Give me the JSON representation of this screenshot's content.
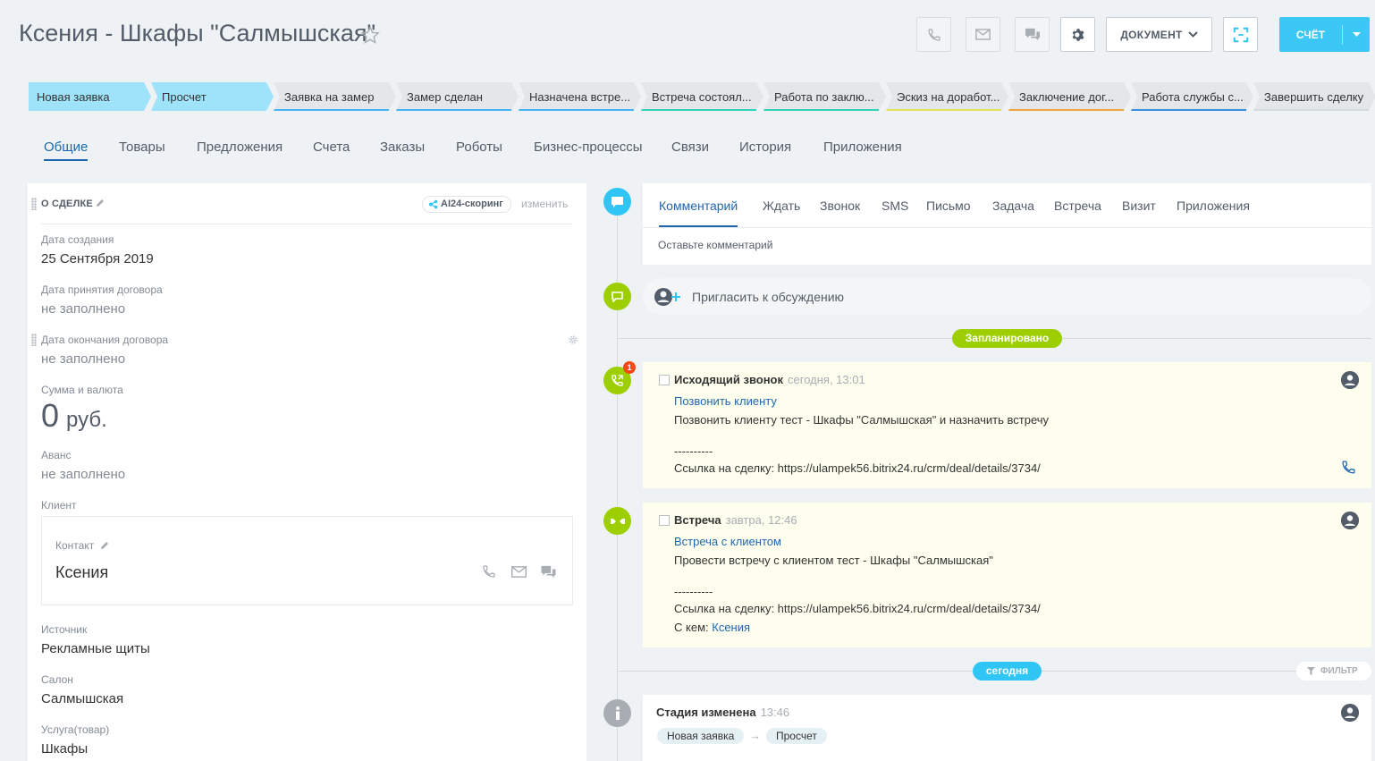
{
  "header": {
    "title": "Ксения - Шкафы \"Салмышская\"",
    "document_label": "ДОКУМЕНТ",
    "bill_label": "СЧЁТ"
  },
  "stages": [
    {
      "label": "Новая заявка",
      "color": "#9ee3f9",
      "done": true
    },
    {
      "label": "Просчет",
      "color": "#9ee3f9",
      "done": true
    },
    {
      "label": "Заявка на замер",
      "color": "#47b4f5"
    },
    {
      "label": "Замер сделан",
      "color": "#47b4f5"
    },
    {
      "label": "Назначена встре...",
      "color": "#47b4f5"
    },
    {
      "label": "Встреча состоял...",
      "color": "#32d4b9"
    },
    {
      "label": "Работа по заклю...",
      "color": "#32d4b9"
    },
    {
      "label": "Эскиз на доработ...",
      "color": "#e3e25a"
    },
    {
      "label": "Заключение дог...",
      "color": "#f0a43e"
    },
    {
      "label": "Работа службы с...",
      "color": "#3b8de0"
    },
    {
      "label": "Завершить сделку",
      "color": "#d5dadd"
    }
  ],
  "tabs": [
    "Общие",
    "Товары",
    "Предложения",
    "Счета",
    "Заказы",
    "Роботы",
    "Бизнес-процессы",
    "Связи",
    "История",
    "Приложения"
  ],
  "about": {
    "title": "О СДЕЛКЕ",
    "ai_badge": "AI24-скоринг",
    "change": "изменить",
    "created_label": "Дата создания",
    "created_value": "25 Сентября 2019",
    "accepted_label": "Дата принятия договора",
    "accepted_value": "не заполнено",
    "end_label": "Дата окончания договора",
    "end_value": "не заполнено",
    "sum_label": "Сумма и валюта",
    "sum_value": "0",
    "currency": "руб.",
    "advance_label": "Аванс",
    "advance_value": "не заполнено",
    "client_label": "Клиент",
    "contact_label": "Контакт",
    "contact_name": "Ксения",
    "source_label": "Источник",
    "source_value": "Рекламные щиты",
    "salon_label": "Салон",
    "salon_value": "Салмышская",
    "service_label": "Услуга(товар)",
    "service_value": "Шкафы"
  },
  "comment_tabs": [
    "Комментарий",
    "Ждать",
    "Звонок",
    "SMS",
    "Письмо",
    "Задача",
    "Встреча",
    "Визит",
    "Приложения"
  ],
  "comment_placeholder": "Оставьте комментарий",
  "invite": "Пригласить к обсуждению",
  "planned_label": "Запланировано",
  "call": {
    "title": "Исходящий звонок",
    "time": "сегодня, 13:01",
    "badge": "1",
    "link": "Позвонить клиенту",
    "description": "Позвонить клиенту тест - Шкафы \"Салмышская\" и назначить встречу",
    "divider": "----------",
    "deal_link": "Ссылка на сделку: https://ulampek56.bitrix24.ru/crm/deal/details/3734/"
  },
  "meeting": {
    "title": "Встреча",
    "time": "завтра, 12:46",
    "link": "Встреча с клиентом",
    "description": "Провести встречу с клиентом тест - Шкафы \"Салмышская\"",
    "divider": "----------",
    "deal_link": "Ссылка на сделку: https://ulampek56.bitrix24.ru/crm/deal/details/3734/",
    "with_label": "С кем:",
    "with_name": "Ксения"
  },
  "today_label": "сегодня",
  "filter_label": "ФИЛЬТР",
  "stage_change": {
    "title": "Стадия изменена",
    "time": "13:46",
    "from": "Новая заявка",
    "arrow": "→",
    "to": "Просчет"
  },
  "colors": {
    "accent": "#2067b0",
    "bill": "#3bc8f5",
    "timeline_green": "#9dcf00",
    "timeline_blue": "#2fc6f6"
  }
}
